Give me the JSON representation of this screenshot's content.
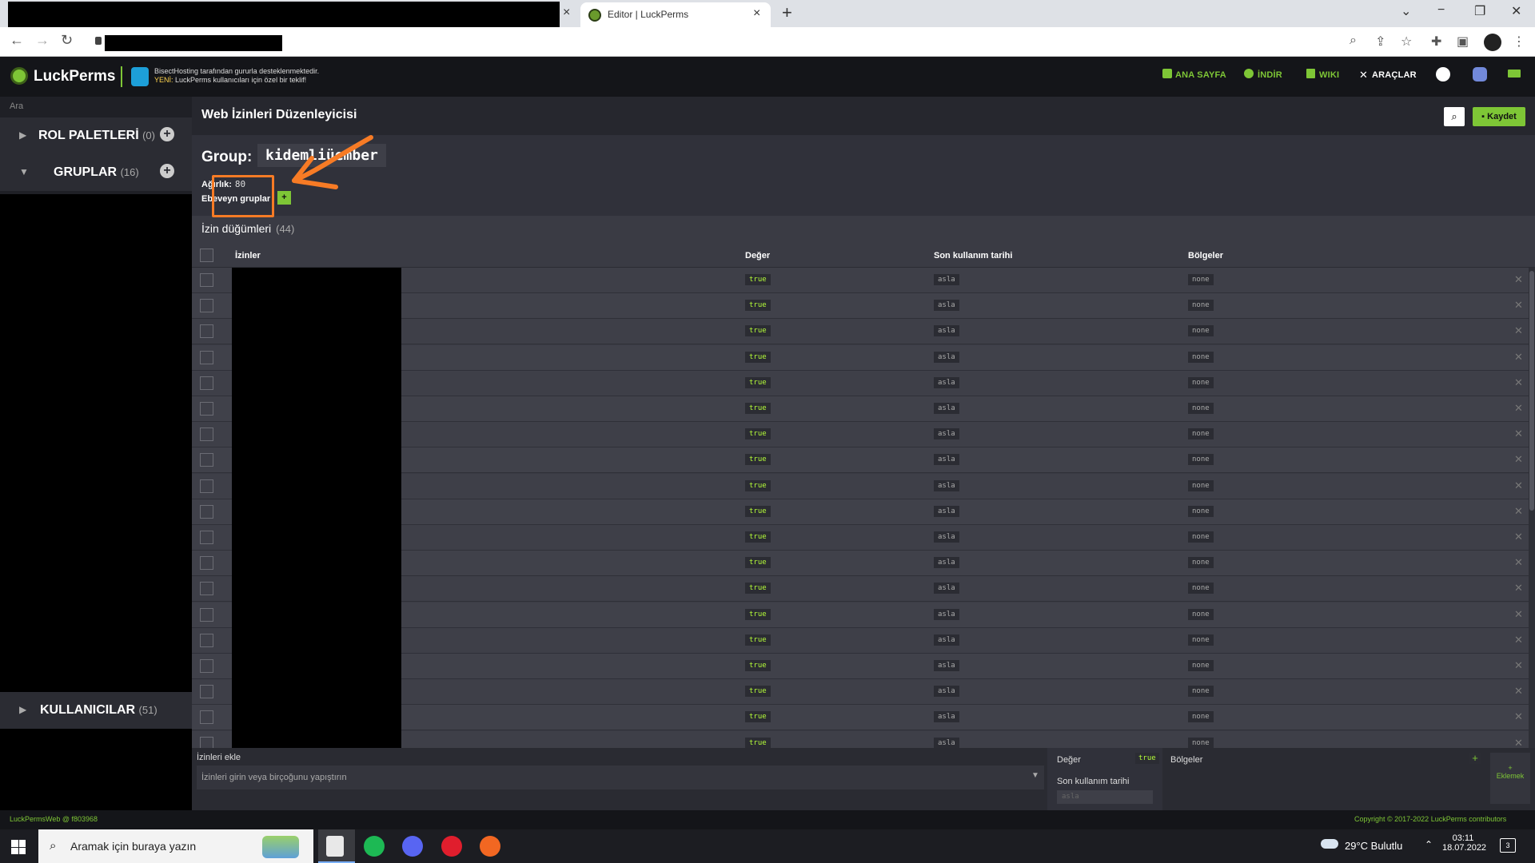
{
  "browser": {
    "tab_title": "Editor | LuckPerms",
    "new_tab": "+",
    "close": "×",
    "ctrl_minimize": "−",
    "ctrl_restore": "❐",
    "ctrl_close": "✕",
    "ctrl_down": "⌄"
  },
  "header": {
    "brand": "LuckPerms",
    "sponsor_line1": "BisectHosting tarafından gururla desteklenmektedir.",
    "sponsor_new": "YENİ:",
    "sponsor_line2": " LuckPerms kullanıcıları için özel bir teklif!",
    "nav": [
      "ANA SAYFA",
      "İNDİR",
      "WIKI",
      "ARAÇLAR"
    ]
  },
  "sidebar": {
    "search_placeholder": "Ara",
    "sections": [
      {
        "label": "ROL PALETLERİ",
        "count": "(0)"
      },
      {
        "label": "GRUPLAR",
        "count": "(16)"
      },
      {
        "label": "KULLANICILAR",
        "count": "(51)"
      }
    ]
  },
  "main": {
    "title": "Web İzinleri Düzenleyicisi",
    "save_label": "Kaydet",
    "group_label": "Group:",
    "group_name": "kidemliüember",
    "weight_label": "Ağırlık:",
    "weight_value": "80",
    "parents_label": "Ebeveyn gruplar",
    "parents_add": "+",
    "nodes_title": "İzin düğümleri",
    "nodes_count": "(44)",
    "columns": {
      "perms": "İzinler",
      "value": "Değer",
      "last_used": "Son kullanım tarihi",
      "contexts": "Bölgeler"
    },
    "row_value": "true",
    "row_last_used": "asla",
    "row_context": "none",
    "row_count_visible": 19,
    "add_panel": {
      "title": "İzinleri ekle",
      "placeholder": "İzinleri girin veya birçoğunu yapıştırın",
      "value_label": "Değer",
      "value_pill": "true",
      "last_used_label": "Son kullanım tarihi",
      "last_used_placeholder": "asla",
      "contexts_label": "Bölgeler",
      "add_label": "Eklemek",
      "add_plus": "+"
    }
  },
  "footer": {
    "left": "LuckPermsWeb @ f803968",
    "right": "Copyright © 2017-2022 LuckPerms contributors"
  },
  "taskbar": {
    "search_text": "Aramak için buraya yazın",
    "weather": "29°C  Bulutlu",
    "time": "03:11",
    "date": "18.07.2022",
    "notif_count": "3"
  },
  "colors": {
    "accent": "#7ec636",
    "annotation": "#f77b25",
    "true_text": "#b6ff39"
  }
}
